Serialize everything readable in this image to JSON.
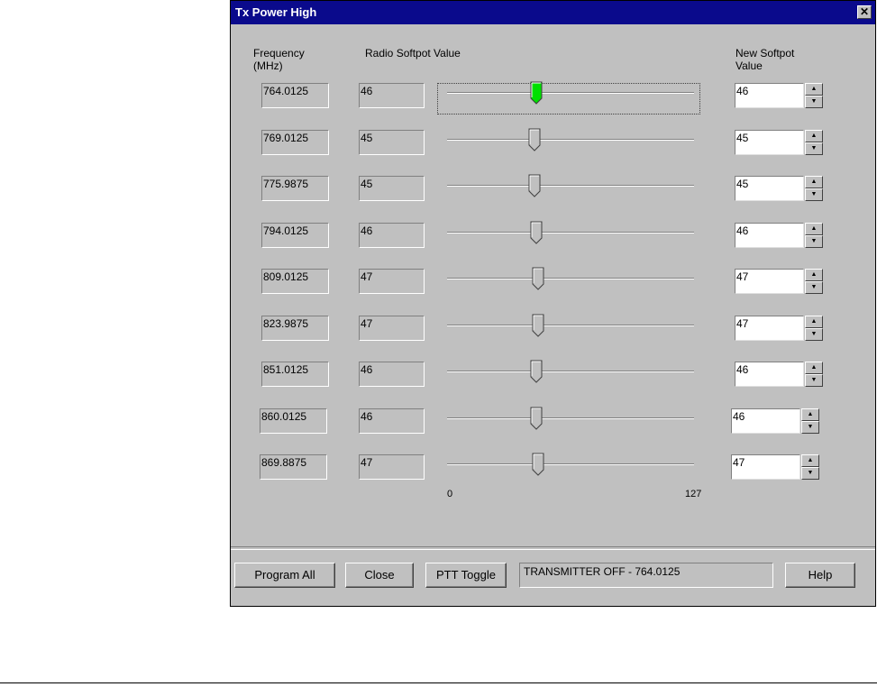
{
  "window": {
    "title": "Tx Power High"
  },
  "headers": {
    "frequency": "Frequency (MHz)",
    "radio_softpot": "Radio Softpot Value",
    "new_softpot": "New Softpot Value"
  },
  "rows": [
    {
      "frequency": "764.0125",
      "radio": "46",
      "new": "46",
      "slider": 46,
      "active": true
    },
    {
      "frequency": "769.0125",
      "radio": "45",
      "new": "45",
      "slider": 45,
      "active": false
    },
    {
      "frequency": "775.9875",
      "radio": "45",
      "new": "45",
      "slider": 45,
      "active": false
    },
    {
      "frequency": "794.0125",
      "radio": "46",
      "new": "46",
      "slider": 46,
      "active": false
    },
    {
      "frequency": "809.0125",
      "radio": "47",
      "new": "47",
      "slider": 47,
      "active": false
    },
    {
      "frequency": "823.9875",
      "radio": "47",
      "new": "47",
      "slider": 47,
      "active": false
    },
    {
      "frequency": "851.0125",
      "radio": "46",
      "new": "46",
      "slider": 46,
      "active": false
    },
    {
      "frequency": "860.0125",
      "radio": "46",
      "new": "46",
      "slider": 46,
      "active": false
    },
    {
      "frequency": "869.8875",
      "radio": "47",
      "new": "47",
      "slider": 47,
      "active": false
    }
  ],
  "slider_scale": {
    "min": "0",
    "max": "127"
  },
  "buttons": {
    "program_all": "Program All",
    "close": "Close",
    "ptt_toggle": "PTT Toggle",
    "help": "Help"
  },
  "status_text": "TRANSMITTER OFF - 764.0125",
  "colors": {
    "titlebar": "#0a0a8c",
    "active_thumb": "#00e000",
    "face": "#c0c0c0"
  }
}
